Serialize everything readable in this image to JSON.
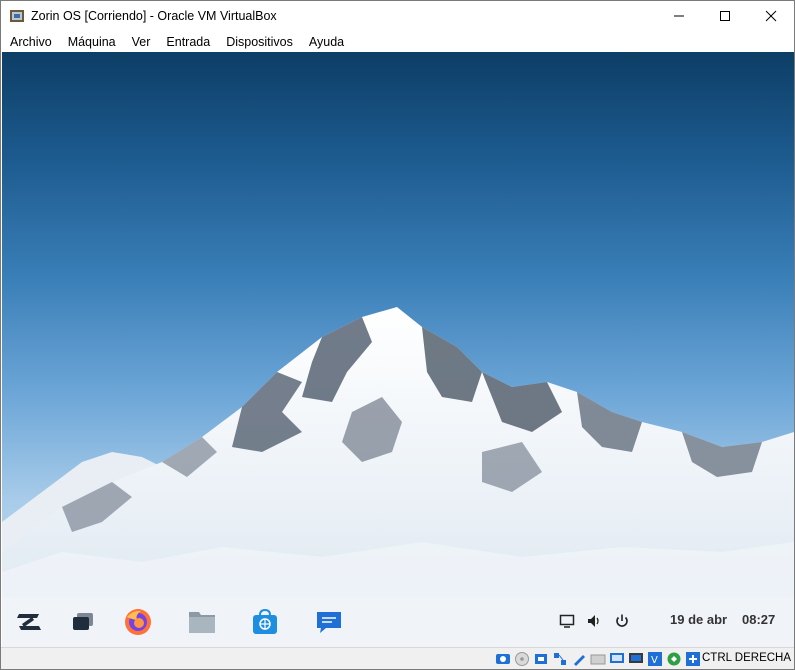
{
  "window": {
    "title": "Zorin OS [Corriendo] - Oracle VM VirtualBox",
    "controls": {
      "minimize": "minimize-icon",
      "maximize": "maximize-icon",
      "close": "close-icon"
    }
  },
  "menubar": {
    "items": [
      "Archivo",
      "Máquina",
      "Ver",
      "Entrada",
      "Dispositivos",
      "Ayuda"
    ]
  },
  "guest": {
    "wallpaper": "snowy-mountain-peak",
    "dock": {
      "apps": [
        "zorin-menu-icon",
        "window-switcher-icon",
        "firefox-icon",
        "files-icon",
        "software-store-icon",
        "messages-icon"
      ],
      "tray": [
        "screen-icon",
        "volume-icon",
        "power-icon"
      ],
      "date": "19 de abr",
      "time": "08:27"
    }
  },
  "statusbar": {
    "icons": [
      "hard-disk-icon",
      "optical-drive-icon",
      "audio-icon",
      "network-icon",
      "usb-icon",
      "shared-folder-icon",
      "display-icon",
      "video-capture-icon",
      "virtualization-icon",
      "mouse-integration-icon",
      "guest-additions-icon"
    ],
    "host_key": "CTRL DERECHA"
  },
  "colors": {
    "accent": "#1e6fd6",
    "sky_top": "#0d3e66",
    "sky_bottom": "#d6e6f2"
  }
}
